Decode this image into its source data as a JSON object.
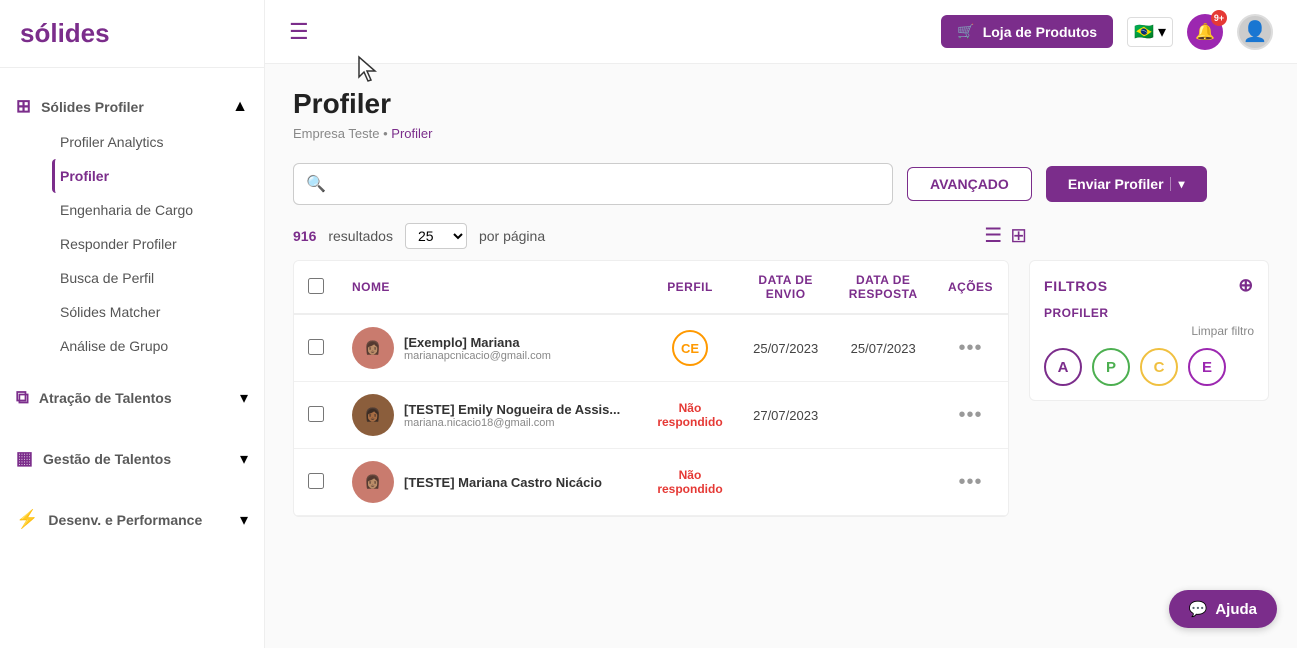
{
  "app": {
    "logo": "sólides",
    "title": "Profiler",
    "breadcrumb_home": "Empresa Teste",
    "breadcrumb_sep": "•",
    "breadcrumb_current": "Profiler"
  },
  "topbar": {
    "hamburger_icon": "☰",
    "shop_button": "Loja de Produtos",
    "shop_icon": "🛒",
    "flag": "🇧🇷",
    "flag_expand": "▾",
    "notification_count": "9+",
    "notification_icon": "🔔"
  },
  "search": {
    "placeholder": "",
    "avancado_label": "AVANÇADO",
    "enviar_label": "Enviar Profiler"
  },
  "results": {
    "count": "916",
    "count_label": "resultados",
    "per_page": "25",
    "per_page_label": "por página"
  },
  "table": {
    "columns": [
      {
        "key": "nome",
        "label": "NOME"
      },
      {
        "key": "perfil",
        "label": "PERFIL"
      },
      {
        "key": "data_envio",
        "label": "DATA DE\nENVIO"
      },
      {
        "key": "data_resposta",
        "label": "DATA DE\nRESPOSTA"
      },
      {
        "key": "acoes",
        "label": "AÇÕES"
      }
    ],
    "rows": [
      {
        "id": 1,
        "name": "[Exemplo] Mariana",
        "email": "marianapcnicacio@gmail.com",
        "profile_code": "CE",
        "profile_type": "CE",
        "data_envio": "25/07/2023",
        "data_resposta": "25/07/2023",
        "avatar_color": "#c97b6e"
      },
      {
        "id": 2,
        "name": "[TESTE] Emily Nogueira de Assis...",
        "email": "mariana.nicacio18@gmail.com",
        "profile_code": "NR",
        "profile_type": "nao_respondido",
        "data_envio": "27/07/2023",
        "data_resposta": "",
        "avatar_color": "#8b5e3c"
      },
      {
        "id": 3,
        "name": "[TESTE] Mariana Castro Nicácio",
        "email": "",
        "profile_code": "NR",
        "profile_type": "nao_respondido",
        "data_envio": "",
        "data_resposta": "",
        "avatar_color": "#c97b6e"
      }
    ],
    "nao_respondido_label": "Não\nrespondido",
    "acoes_icon": "•••"
  },
  "filters": {
    "title": "FILTROS",
    "profiler_label": "PROFILER",
    "limpar_label": "Limpar filtro",
    "collapse_icon": "⊕",
    "circles": [
      {
        "letter": "A",
        "class": "fc-a"
      },
      {
        "letter": "P",
        "class": "fc-p"
      },
      {
        "letter": "C",
        "class": "fc-c"
      },
      {
        "letter": "E",
        "class": "fc-e"
      }
    ]
  },
  "sidebar": {
    "solides_profiler_label": "Sólides Profiler",
    "items": [
      {
        "label": "Profiler Analytics",
        "active": false
      },
      {
        "label": "Profiler",
        "active": true
      },
      {
        "label": "Engenharia de Cargo",
        "active": false
      },
      {
        "label": "Responder Profiler",
        "active": false
      },
      {
        "label": "Busca de Perfil",
        "active": false
      },
      {
        "label": "Sólides Matcher",
        "active": false
      },
      {
        "label": "Análise de Grupo",
        "active": false
      }
    ],
    "sections": [
      {
        "label": "Atração de Talentos"
      },
      {
        "label": "Gestão de Talentos"
      },
      {
        "label": "Desenv. e Performance"
      }
    ]
  },
  "ajuda": {
    "label": "Ajuda",
    "icon": "💬"
  }
}
